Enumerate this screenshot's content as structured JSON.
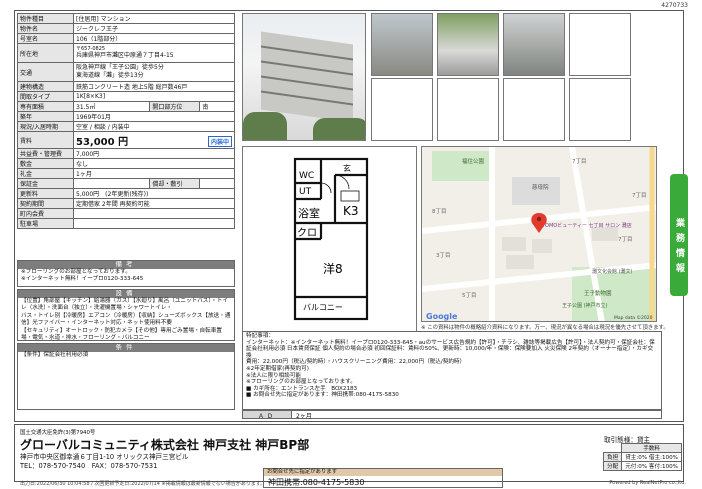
{
  "doc_id": "4270733",
  "spec": {
    "rows": [
      {
        "k": "物件種目",
        "v": "[住居用] マンション"
      },
      {
        "k": "物件名",
        "v": "ジークレフ王子"
      },
      {
        "k": "号室名",
        "v": "106（1階部分）"
      }
    ],
    "address_label": "所在地",
    "address_zip": "〒657-0825",
    "address": "兵庫県神戸市灘区中原通７丁目4-15",
    "transit_label": "交通",
    "transit_1": "阪急神戸線「王子公園」徒歩5分",
    "transit_2": "東海道線「灘」徒歩13分",
    "rows2": [
      {
        "k": "建物構造",
        "v": "鉄筋コンクリート造 地上5階 総戸数46戸"
      },
      {
        "k": "間取タイプ",
        "v": "1K[8×K3]"
      }
    ],
    "area_label": "専有面積",
    "area": "31.5㎡",
    "direction_label": "開口部方位",
    "direction": "南",
    "rows3": [
      {
        "k": "築年",
        "v": "1969年01月"
      },
      {
        "k": "現況/入居時期",
        "v": "空室 / 相談 / 内装中"
      }
    ],
    "rent_label": "賃料",
    "rent": "53,000 円",
    "rent_tag": "内装中",
    "rows4": [
      {
        "k": "共益費・管理費",
        "v": "7,000円"
      },
      {
        "k": "敷金",
        "v": "なし"
      },
      {
        "k": "礼金",
        "v": "1ヶ月"
      }
    ],
    "deposit_label": "保証金",
    "deposit": "",
    "amort_label": "償却・敷引",
    "amort": "",
    "rows5": [
      {
        "k": "更新料",
        "v": "5,000円　(2年更新(残存))"
      },
      {
        "k": "契約期間",
        "v": "定期借家 2年間 再契約可能"
      },
      {
        "k": "町内会費",
        "v": ""
      },
      {
        "k": "駐車場",
        "v": ""
      }
    ]
  },
  "biko": {
    "title": "備考",
    "lines": [
      "※フローリングのお部屋となっております。",
      "※インターネット無料！イープロ0120-333-645"
    ]
  },
  "setsubi": {
    "title": "設備",
    "lines": [
      "【位置】角部屋【キッチン】給湯器（ガス）【水廻り】風呂（ユニットバス）・トイレ（水洗）・洗面台（独立）・洗濯機置場・シャワートイレ・",
      "バス・トイレ別【冷暖房】エアコン（冷暖房）【収納】シューズボックス【放送・通信】光ファイバー・インターネット対応・ネット使用料不要",
      "【セキュリティ】オートロック・防犯カメラ【その他】専用ごみ置場・自転車置場・電気・水道・排水・フローリング・バルコニー"
    ]
  },
  "joken": {
    "title": "条件",
    "lines": [
      "【条件】保証会社利用必須"
    ]
  },
  "plan": {
    "labels": {
      "genkan": "玄",
      "wc": "WC",
      "ut": "UT",
      "bath": "浴室",
      "kitchen": "K3",
      "closet": "クロ",
      "room": "洋8",
      "balcony": "バルコニー"
    }
  },
  "map": {
    "park": "福住公園",
    "school": "慈母院",
    "pin_label": "TOMOビューティー 七丁目 サロン 灘店",
    "culture": "灘文化会館 (灘文)",
    "zoo": "王子動物園",
    "ouji_park": "王子公園 (神戸市立)",
    "c1": "7丁目",
    "c2": "8丁目",
    "c3": "7丁目",
    "c4": "3丁目",
    "c5": "5丁目",
    "c6": "7丁目",
    "google": "Google",
    "credit": "Map data ©2020",
    "note": "※ この資料は物件の概略紹介資料になります。万一、現況が異なる場合は現況を優先させて頂きます。"
  },
  "remarks": {
    "lines": [
      "特記事項：",
      "インターネット：※インターネット無料！イープロ0120-333-645・auのサービス広告規約【許可】・チラシ、雑誌等掲載広告【許可】・法人契約可・保証会社：保",
      "証会社利用必須 日本賃貸保証 個人契約の場合必須 初回保証料：賃料の50%、更新時：10,000/年・保険：保険要加入 火災保険 2年契約（オーナー指定）・カギ交換",
      "費用：22,000円（税込/契約時）・ハウスクリーニング費用：22,000円（税込/契約時）",
      "※2年定期借家(再契約可)",
      "※法人に限り相談可能",
      "※フローリングのお部屋となっております。",
      "■ カギ所在：エントランス左手　BOX2183",
      "■ お問合せ先に指定があります：神田携帯:080-4175-5830"
    ]
  },
  "ad": {
    "label": "ＡＤ",
    "value": "2ヶ月"
  },
  "side_tab": "業務情報",
  "footer": {
    "license": "国土交通大臣免許(3)第7940号",
    "company": "グローバルコミュニティ株式会社 神戸支社 神戸BP部",
    "address": "神戸市中央区御幸通６丁目1-10 オリックス神戸三宮ビル",
    "tel": "TEL：078-570-7540　FAX：078-570-7531",
    "dates": "出力日:2022/06/30 10:04:58 / 次回更新予定日:2022/07/14 ※掲載情報は最新情報でない場合があります。",
    "contact_label": "お問合せ先に指定があります",
    "contact": "神田携帯:080-4175-5830",
    "trade_label": "取引態様：",
    "trade_value": "貸主",
    "fee_head": "手数料",
    "fee_rows": [
      {
        "k": "負担",
        "v": "貸主:0% 借主:100%"
      },
      {
        "k": "分配",
        "v": "元付:0% 客付:100%"
      }
    ],
    "powered": "Powered by RealNetPro co.,ltd."
  }
}
